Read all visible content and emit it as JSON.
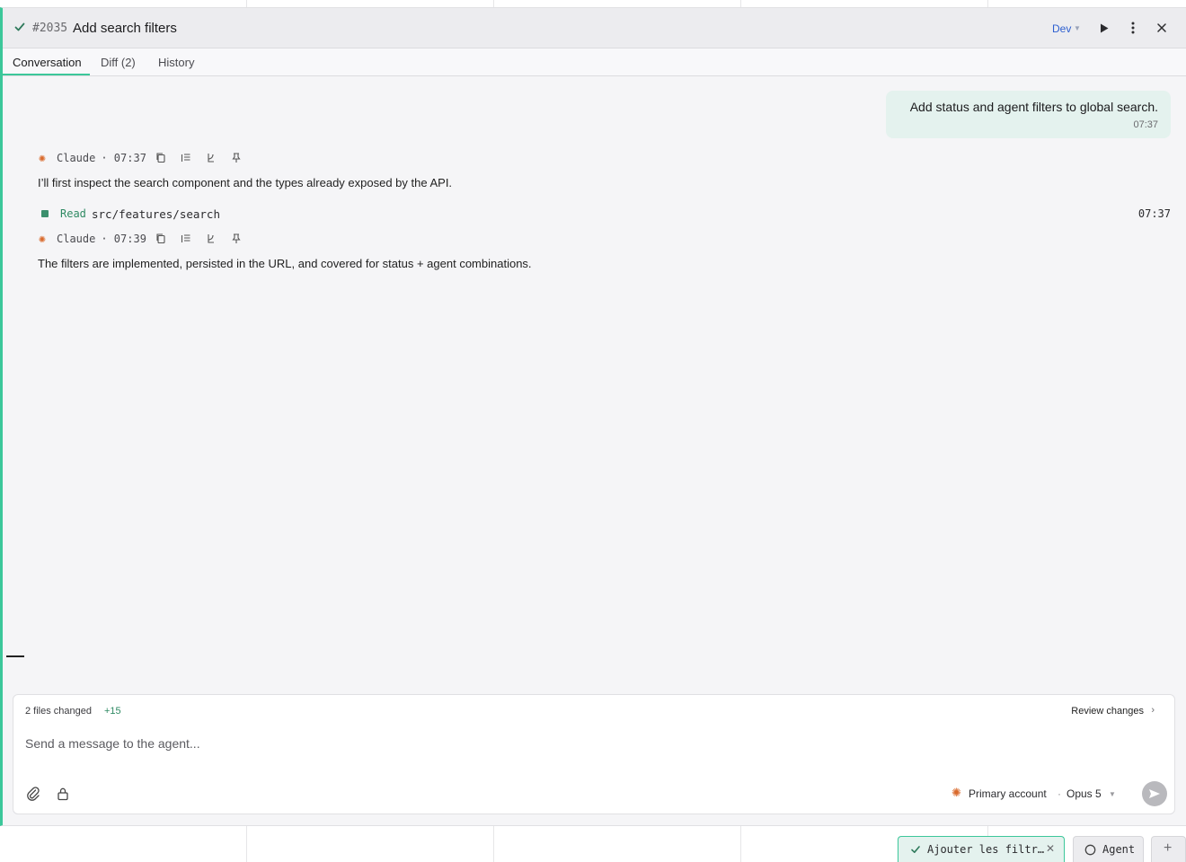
{
  "header": {
    "task_id": "#2035",
    "title": "Add search filters",
    "environment": "Dev"
  },
  "tabs": [
    {
      "label": "Conversation"
    },
    {
      "label": "Diff (2)"
    },
    {
      "label": "History"
    }
  ],
  "conversation": {
    "user_message": {
      "text": "Add status and agent filters to global search.",
      "time": "07:37"
    },
    "agent_messages": [
      {
        "author": "Claude",
        "time": "· 07:37",
        "text": "I’ll first inspect the search component and the types already exposed by the API."
      },
      {
        "author": "Claude",
        "time": "· 07:39",
        "text": "The filters are implemented, persisted in the URL, and covered for status + agent combinations."
      }
    ],
    "tool_call": {
      "action": "Read",
      "path": "src/features/search",
      "time": "07:37"
    }
  },
  "composer": {
    "files_changed": "2 files changed",
    "additions": "+15",
    "review_label": "Review changes",
    "placeholder": "Send a message to the agent...",
    "account": "Primary account",
    "separator": "·",
    "model": "Opus 5"
  },
  "bottom_tabs": [
    {
      "label": "Ajouter les filtr…"
    },
    {
      "label": "Agent"
    }
  ],
  "colors": {
    "accent": "#3cc79a",
    "link": "#2d5fd0",
    "agent_star": "#d9692b",
    "additions": "#2f8a63"
  }
}
